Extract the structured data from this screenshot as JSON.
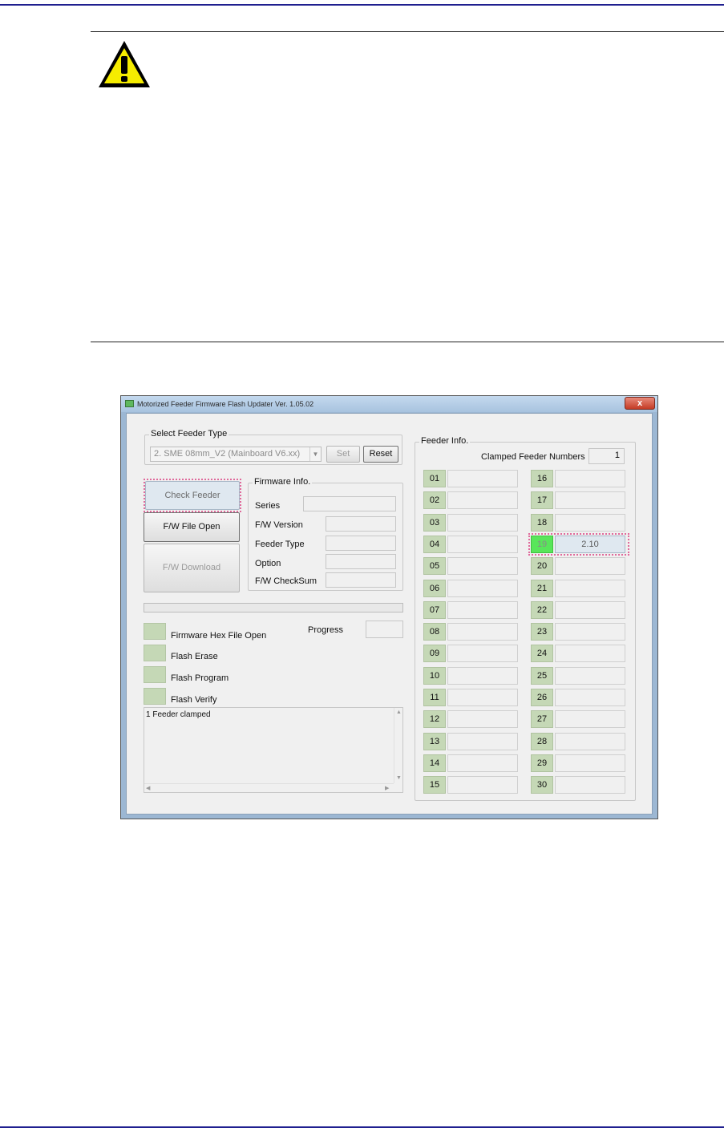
{
  "window": {
    "title": "Motorized Feeder Firmware Flash Updater Ver. 1.05.02",
    "close_symbol": "x"
  },
  "select_feeder_type": {
    "label": "Select Feeder Type",
    "selected": "2. SME 08mm_V2 (Mainboard V6.xx)",
    "set_label": "Set",
    "reset_label": "Reset"
  },
  "buttons": {
    "check_feeder": "Check Feeder",
    "fw_file_open": "F/W File Open",
    "fw_download": "F/W Download"
  },
  "firmware_info": {
    "label": "Firmware Info.",
    "fields": [
      {
        "label": "Series",
        "value": ""
      },
      {
        "label": "F/W Version",
        "value": ""
      },
      {
        "label": "Feeder Type",
        "value": ""
      },
      {
        "label": "Option",
        "value": ""
      },
      {
        "label": "F/W CheckSum",
        "value": ""
      }
    ]
  },
  "progress": {
    "label": "Progress",
    "value": "",
    "fraction": 0
  },
  "steps": [
    {
      "label": "Firmware Hex File Open"
    },
    {
      "label": "Flash Erase"
    },
    {
      "label": "Flash Program"
    },
    {
      "label": "Flash Verify"
    }
  ],
  "log": {
    "text": "1 Feeder clamped"
  },
  "feeder_info": {
    "label": "Feeder Info.",
    "clamped_label": "Clamped Feeder Numbers",
    "clamped_value": "1",
    "slots": [
      {
        "num": "01",
        "value": ""
      },
      {
        "num": "02",
        "value": ""
      },
      {
        "num": "03",
        "value": ""
      },
      {
        "num": "04",
        "value": ""
      },
      {
        "num": "05",
        "value": ""
      },
      {
        "num": "06",
        "value": ""
      },
      {
        "num": "07",
        "value": ""
      },
      {
        "num": "08",
        "value": ""
      },
      {
        "num": "09",
        "value": ""
      },
      {
        "num": "10",
        "value": ""
      },
      {
        "num": "11",
        "value": ""
      },
      {
        "num": "12",
        "value": ""
      },
      {
        "num": "13",
        "value": ""
      },
      {
        "num": "14",
        "value": ""
      },
      {
        "num": "15",
        "value": ""
      },
      {
        "num": "16",
        "value": ""
      },
      {
        "num": "17",
        "value": ""
      },
      {
        "num": "18",
        "value": ""
      },
      {
        "num": "19",
        "value": "2.10",
        "active": true
      },
      {
        "num": "20",
        "value": ""
      },
      {
        "num": "21",
        "value": ""
      },
      {
        "num": "22",
        "value": ""
      },
      {
        "num": "23",
        "value": ""
      },
      {
        "num": "24",
        "value": ""
      },
      {
        "num": "25",
        "value": ""
      },
      {
        "num": "26",
        "value": ""
      },
      {
        "num": "27",
        "value": ""
      },
      {
        "num": "28",
        "value": ""
      },
      {
        "num": "29",
        "value": ""
      },
      {
        "num": "30",
        "value": ""
      }
    ]
  },
  "colors": {
    "page_rule": "#1f1f8f",
    "indicator": "#c5d8b6",
    "active_feeder": "#58e65a",
    "highlight_outline": "#e0699b"
  }
}
